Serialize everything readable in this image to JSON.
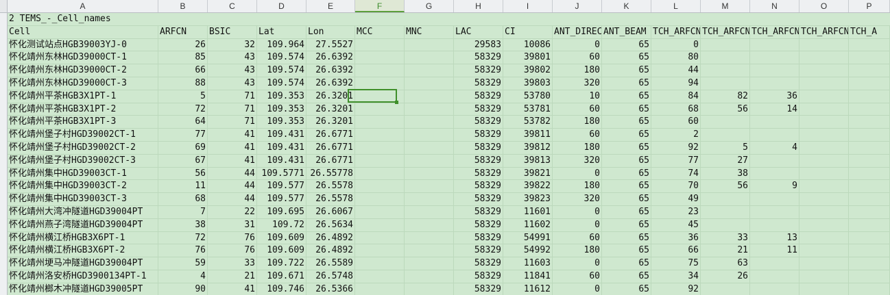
{
  "sheet": {
    "columns": [
      "A",
      "B",
      "C",
      "D",
      "E",
      "F",
      "G",
      "H",
      "I",
      "J",
      "K",
      "L",
      "M",
      "N",
      "O",
      "P"
    ],
    "active_column": "F",
    "title": "2 TEMS_-_Cell_names",
    "headers": [
      "Cell",
      "ARFCN",
      "BSIC",
      "Lat",
      "Lon",
      "MCC",
      "MNC",
      "LAC",
      "CI",
      "ANT_DIREC",
      "ANT_BEAM",
      "TCH_ARFCN",
      "TCH_ARFCN",
      "TCH_ARFCN",
      "TCH_ARFCN",
      "TCH_A"
    ],
    "rows": [
      [
        "怀化测试站点HGB39003YJ-0",
        "26",
        "32",
        "109.964",
        "27.5527",
        "",
        "",
        "29583",
        "10086",
        "0",
        "65",
        "0",
        "",
        "",
        "",
        ""
      ],
      [
        "怀化靖州东林HGD39000CT-1",
        "85",
        "43",
        "109.574",
        "26.6392",
        "",
        "",
        "58329",
        "39801",
        "60",
        "65",
        "80",
        "",
        "",
        "",
        ""
      ],
      [
        "怀化靖州东林HGD39000CT-2",
        "66",
        "43",
        "109.574",
        "26.6392",
        "",
        "",
        "58329",
        "39802",
        "180",
        "65",
        "44",
        "",
        "",
        "",
        ""
      ],
      [
        "怀化靖州东林HGD39000CT-3",
        "88",
        "43",
        "109.574",
        "26.6392",
        "",
        "",
        "58329",
        "39803",
        "320",
        "65",
        "94",
        "",
        "",
        "",
        ""
      ],
      [
        "怀化靖州平茶HGB3X1PT-1",
        "5",
        "71",
        "109.353",
        "26.3201",
        "",
        "",
        "58329",
        "53780",
        "10",
        "65",
        "84",
        "82",
        "36",
        "",
        ""
      ],
      [
        "怀化靖州平茶HGB3X1PT-2",
        "72",
        "71",
        "109.353",
        "26.3201",
        "",
        "",
        "58329",
        "53781",
        "60",
        "65",
        "68",
        "56",
        "14",
        "",
        ""
      ],
      [
        "怀化靖州平茶HGB3X1PT-3",
        "64",
        "71",
        "109.353",
        "26.3201",
        "",
        "",
        "58329",
        "53782",
        "180",
        "65",
        "60",
        "",
        "",
        "",
        ""
      ],
      [
        "怀化靖州堡子村HGD39002CT-1",
        "77",
        "41",
        "109.431",
        "26.6771",
        "",
        "",
        "58329",
        "39811",
        "60",
        "65",
        "2",
        "",
        "",
        "",
        ""
      ],
      [
        "怀化靖州堡子村HGD39002CT-2",
        "69",
        "41",
        "109.431",
        "26.6771",
        "",
        "",
        "58329",
        "39812",
        "180",
        "65",
        "92",
        "5",
        "4",
        "",
        ""
      ],
      [
        "怀化靖州堡子村HGD39002CT-3",
        "67",
        "41",
        "109.431",
        "26.6771",
        "",
        "",
        "58329",
        "39813",
        "320",
        "65",
        "77",
        "27",
        "",
        "",
        ""
      ],
      [
        "怀化靖州集中HGD39003CT-1",
        "56",
        "44",
        "109.5771",
        "26.55778",
        "",
        "",
        "58329",
        "39821",
        "0",
        "65",
        "74",
        "38",
        "",
        "",
        ""
      ],
      [
        "怀化靖州集中HGD39003CT-2",
        "11",
        "44",
        "109.577",
        "26.5578",
        "",
        "",
        "58329",
        "39822",
        "180",
        "65",
        "70",
        "56",
        "9",
        "",
        ""
      ],
      [
        "怀化靖州集中HGD39003CT-3",
        "68",
        "44",
        "109.577",
        "26.5578",
        "",
        "",
        "58329",
        "39823",
        "320",
        "65",
        "49",
        "",
        "",
        "",
        ""
      ],
      [
        "怀化靖州大湾冲隧道HGD39004PT",
        "7",
        "22",
        "109.695",
        "26.6067",
        "",
        "",
        "58329",
        "11601",
        "0",
        "65",
        "23",
        "",
        "",
        "",
        ""
      ],
      [
        "怀化靖州燕子湾隧道HGD39004PT",
        "38",
        "31",
        "109.72",
        "26.5634",
        "",
        "",
        "58329",
        "11602",
        "0",
        "65",
        "45",
        "",
        "",
        "",
        ""
      ],
      [
        "怀化靖州横江桥HGB3X6PT-1",
        "72",
        "76",
        "109.609",
        "26.4892",
        "",
        "",
        "58329",
        "54991",
        "60",
        "65",
        "36",
        "33",
        "13",
        "",
        ""
      ],
      [
        "怀化靖州横江桥HGB3X6PT-2",
        "76",
        "76",
        "109.609",
        "26.4892",
        "",
        "",
        "58329",
        "54992",
        "180",
        "65",
        "66",
        "21",
        "11",
        "",
        ""
      ],
      [
        "怀化靖州埂马冲隧道HGD39004PT",
        "59",
        "33",
        "109.722",
        "26.5589",
        "",
        "",
        "58329",
        "11603",
        "0",
        "65",
        "75",
        "63",
        "",
        "",
        ""
      ],
      [
        "怀化靖州洛安桥HGD3900134PT-1",
        "4",
        "21",
        "109.671",
        "26.5748",
        "",
        "",
        "58329",
        "11841",
        "60",
        "65",
        "34",
        "26",
        "",
        "",
        ""
      ],
      [
        "怀化靖州榔木冲隧道HGD39005PT",
        "90",
        "41",
        "109.746",
        "26.5366",
        "",
        "",
        "58329",
        "11612",
        "0",
        "65",
        "92",
        "",
        "",
        "",
        ""
      ]
    ]
  }
}
